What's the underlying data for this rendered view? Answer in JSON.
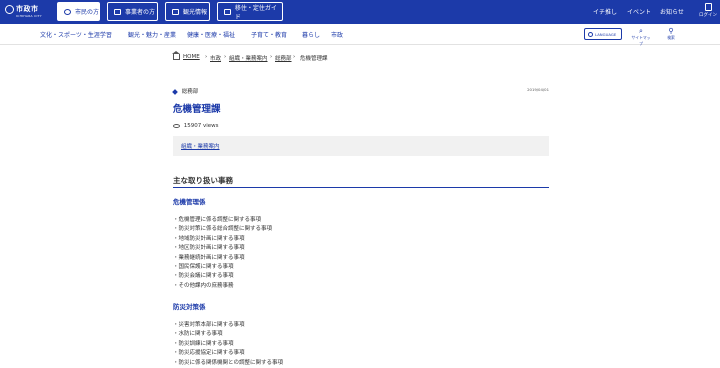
{
  "header": {
    "logo_text": "市政市",
    "logo_sub": "ICHIHARA CITY",
    "tabs": [
      {
        "label": "市民の方",
        "icon": "person-icon",
        "active": true
      },
      {
        "label": "事業者の方",
        "icon": "briefcase-icon",
        "active": false
      },
      {
        "label": "観光情報",
        "icon": "camera-icon",
        "active": false
      },
      {
        "label": "移住・定住ガイド",
        "icon": "house-icon",
        "active": false
      }
    ],
    "links": [
      "イチ推し",
      "イベント",
      "お知らせ"
    ],
    "login_label": "ログイン",
    "accent_color": "#1c3aa9"
  },
  "nav": {
    "categories": [
      "文化・スポーツ・生涯学習",
      "観光・魅力・産業",
      "健康・医療・福祉",
      "子育て・教育",
      "暮らし",
      "市政"
    ],
    "language_label": "LANGUAGE",
    "sitemap_label": "サイトマップ",
    "search_label": "検索"
  },
  "breadcrumb": {
    "items": [
      "HOME",
      "市政",
      "組織・業務案内",
      "総務部",
      "危機管理課"
    ]
  },
  "page": {
    "department": "総務部",
    "date": "2019/04/01",
    "title": "危機管理課",
    "views": "15907 views",
    "category_link": "組織・業務案内",
    "section_title": "主な取り扱い事務",
    "groups": [
      {
        "name": "危機管理係",
        "duties": [
          "・危機管理に係る調整に関する事項",
          "・防災対策に係る総合調整に関する事項",
          "・地域防災計画に関する事項",
          "・地区防災計画に関する事項",
          "・業務継続計画に関する事項",
          "・国民保護に関する事項",
          "・防災会議に関する事項",
          "・その他課内の庶務事務"
        ]
      },
      {
        "name": "防災対策係",
        "duties": [
          "・災害対策本部に関する事項",
          "・水防に関する事項",
          "・防災訓練に関する事項",
          "・防災応援協定に関する事項",
          "・防災に係る関係機関との調整に関する事項"
        ]
      }
    ]
  }
}
